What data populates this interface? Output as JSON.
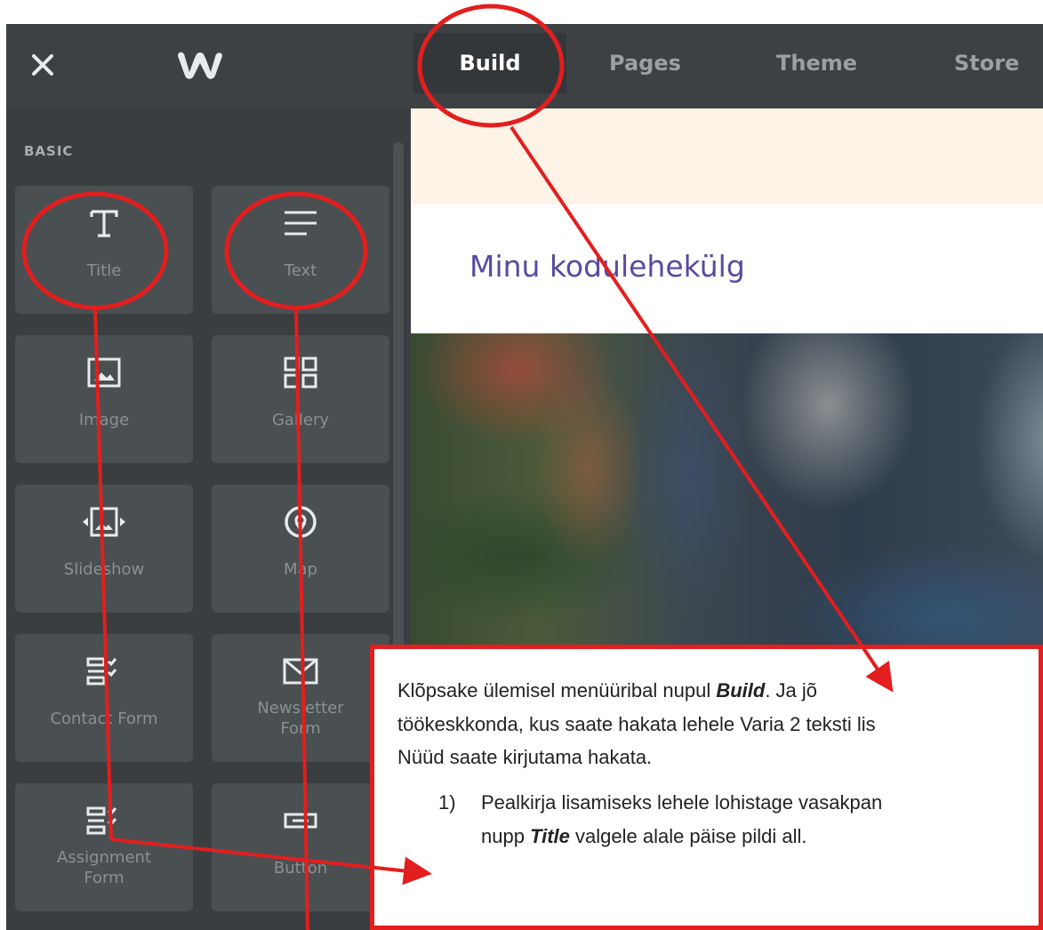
{
  "topbar": {
    "close_icon": "close-icon",
    "logo_icon": "weebly-w-logo",
    "tabs": [
      {
        "label": "Build",
        "active": true
      },
      {
        "label": "Pages",
        "active": false
      },
      {
        "label": "Theme",
        "active": false
      },
      {
        "label": "Store",
        "active": false
      }
    ]
  },
  "sidebar": {
    "section_label": "BASIC",
    "tiles": [
      {
        "label": "Title",
        "icon": "title-t-icon"
      },
      {
        "label": "Text",
        "icon": "text-lines-icon"
      },
      {
        "label": "Image",
        "icon": "image-icon"
      },
      {
        "label": "Gallery",
        "icon": "gallery-grid-icon"
      },
      {
        "label": "Slideshow",
        "icon": "slideshow-icon"
      },
      {
        "label": "Map",
        "icon": "map-pin-icon"
      },
      {
        "label": "Contact Form",
        "icon": "form-check-icon"
      },
      {
        "label_line1": "Newsletter",
        "label_line2": "Form",
        "icon": "envelope-icon"
      },
      {
        "label_line1": "Assignment",
        "label_line2": "Form",
        "icon": "form-check-icon"
      },
      {
        "label": "Button",
        "icon": "button-icon"
      }
    ]
  },
  "site": {
    "title": "Minu kodulehekülg"
  },
  "callout": {
    "line1_pre": "Klõpsake ülemisel menüüribal nupul ",
    "line1_bold": "Build",
    "line1_post": ". Ja jõ",
    "line2": "töökeskkonda, kus saate hakata lehele Varia 2 teksti lis",
    "line3": "Nüüd saate kirjutama hakata.",
    "step_number": "1)",
    "step_line1": "Pealkirja lisamiseks lehele lohistage vasakpan",
    "step_line2_pre": "nupp ",
    "step_line2_bold": "Title",
    "step_line2_post": " valgele alale päise pildi all."
  },
  "colors": {
    "annotation_red": "#e31e1e",
    "topbar_bg": "#3d4143",
    "sidebar_bg": "#3a3e40",
    "tile_bg": "#4a4f52",
    "site_title_color": "#5a4aa0",
    "notice_bg": "#fdf3e6"
  }
}
